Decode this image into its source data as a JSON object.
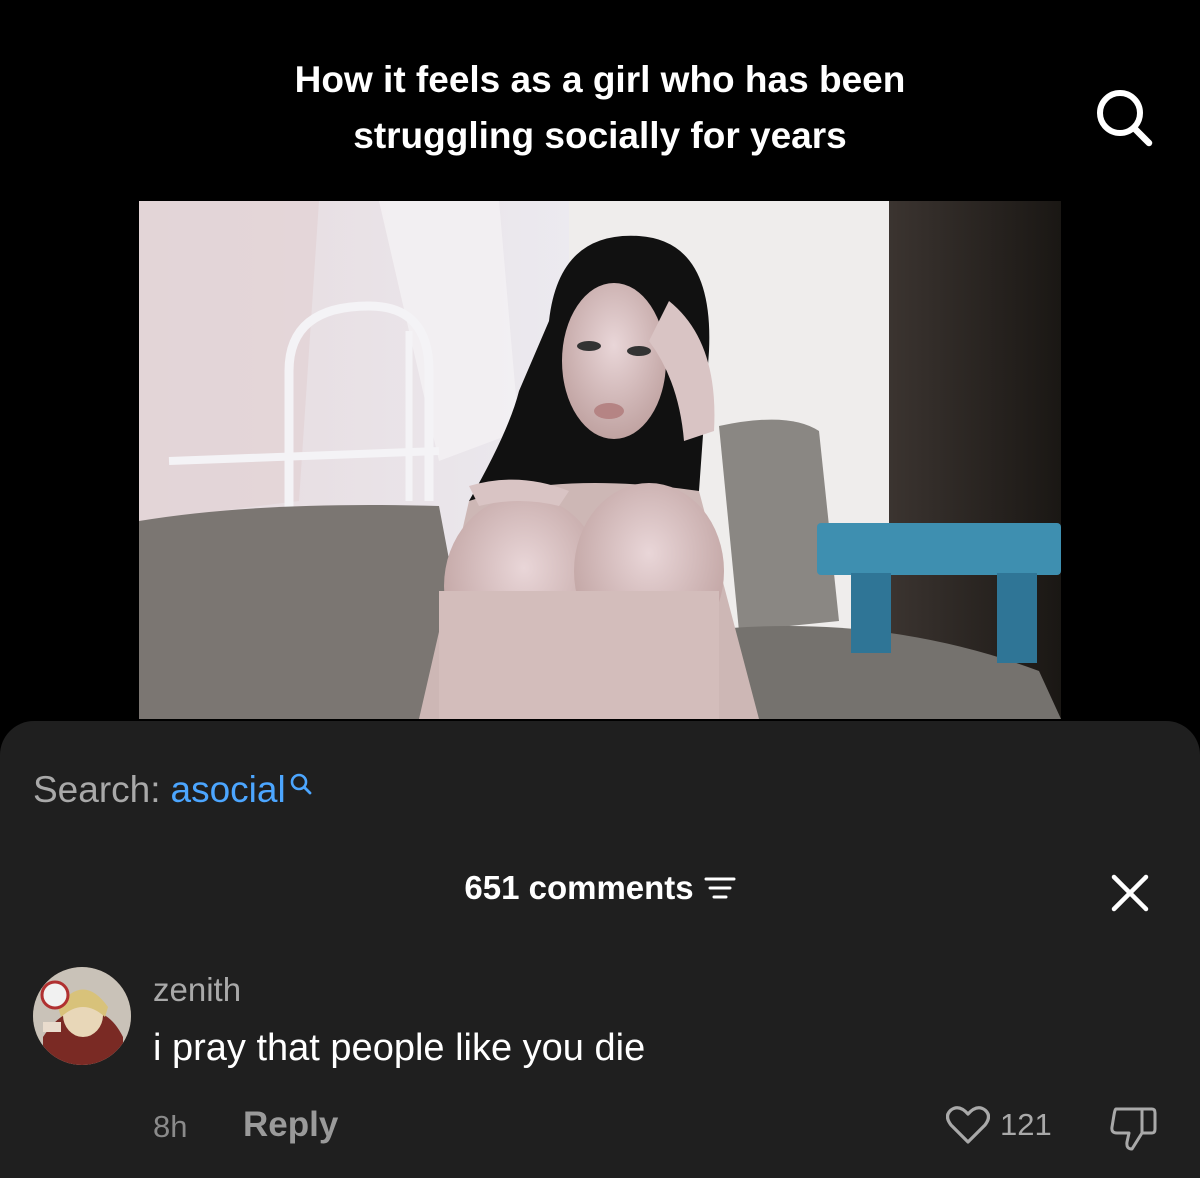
{
  "video": {
    "caption_line1": "How it feels as a girl who has been",
    "caption_line2": "struggling socially for years",
    "search_icon": "search-icon"
  },
  "comments_panel": {
    "search_label": "Search:",
    "search_term": "asocial",
    "search_term_color": "#4ca6ff",
    "comment_count": "651 comments",
    "sort_icon": "sort-icon",
    "close_icon": "close-icon",
    "background": "#1f1f1f"
  },
  "comment": {
    "username": "zenith",
    "text": "i pray that people like you die",
    "timestamp": "8h",
    "reply_label": "Reply",
    "like_count": "121",
    "like_icon": "heart-icon",
    "dislike_icon": "thumbs-down-icon"
  }
}
